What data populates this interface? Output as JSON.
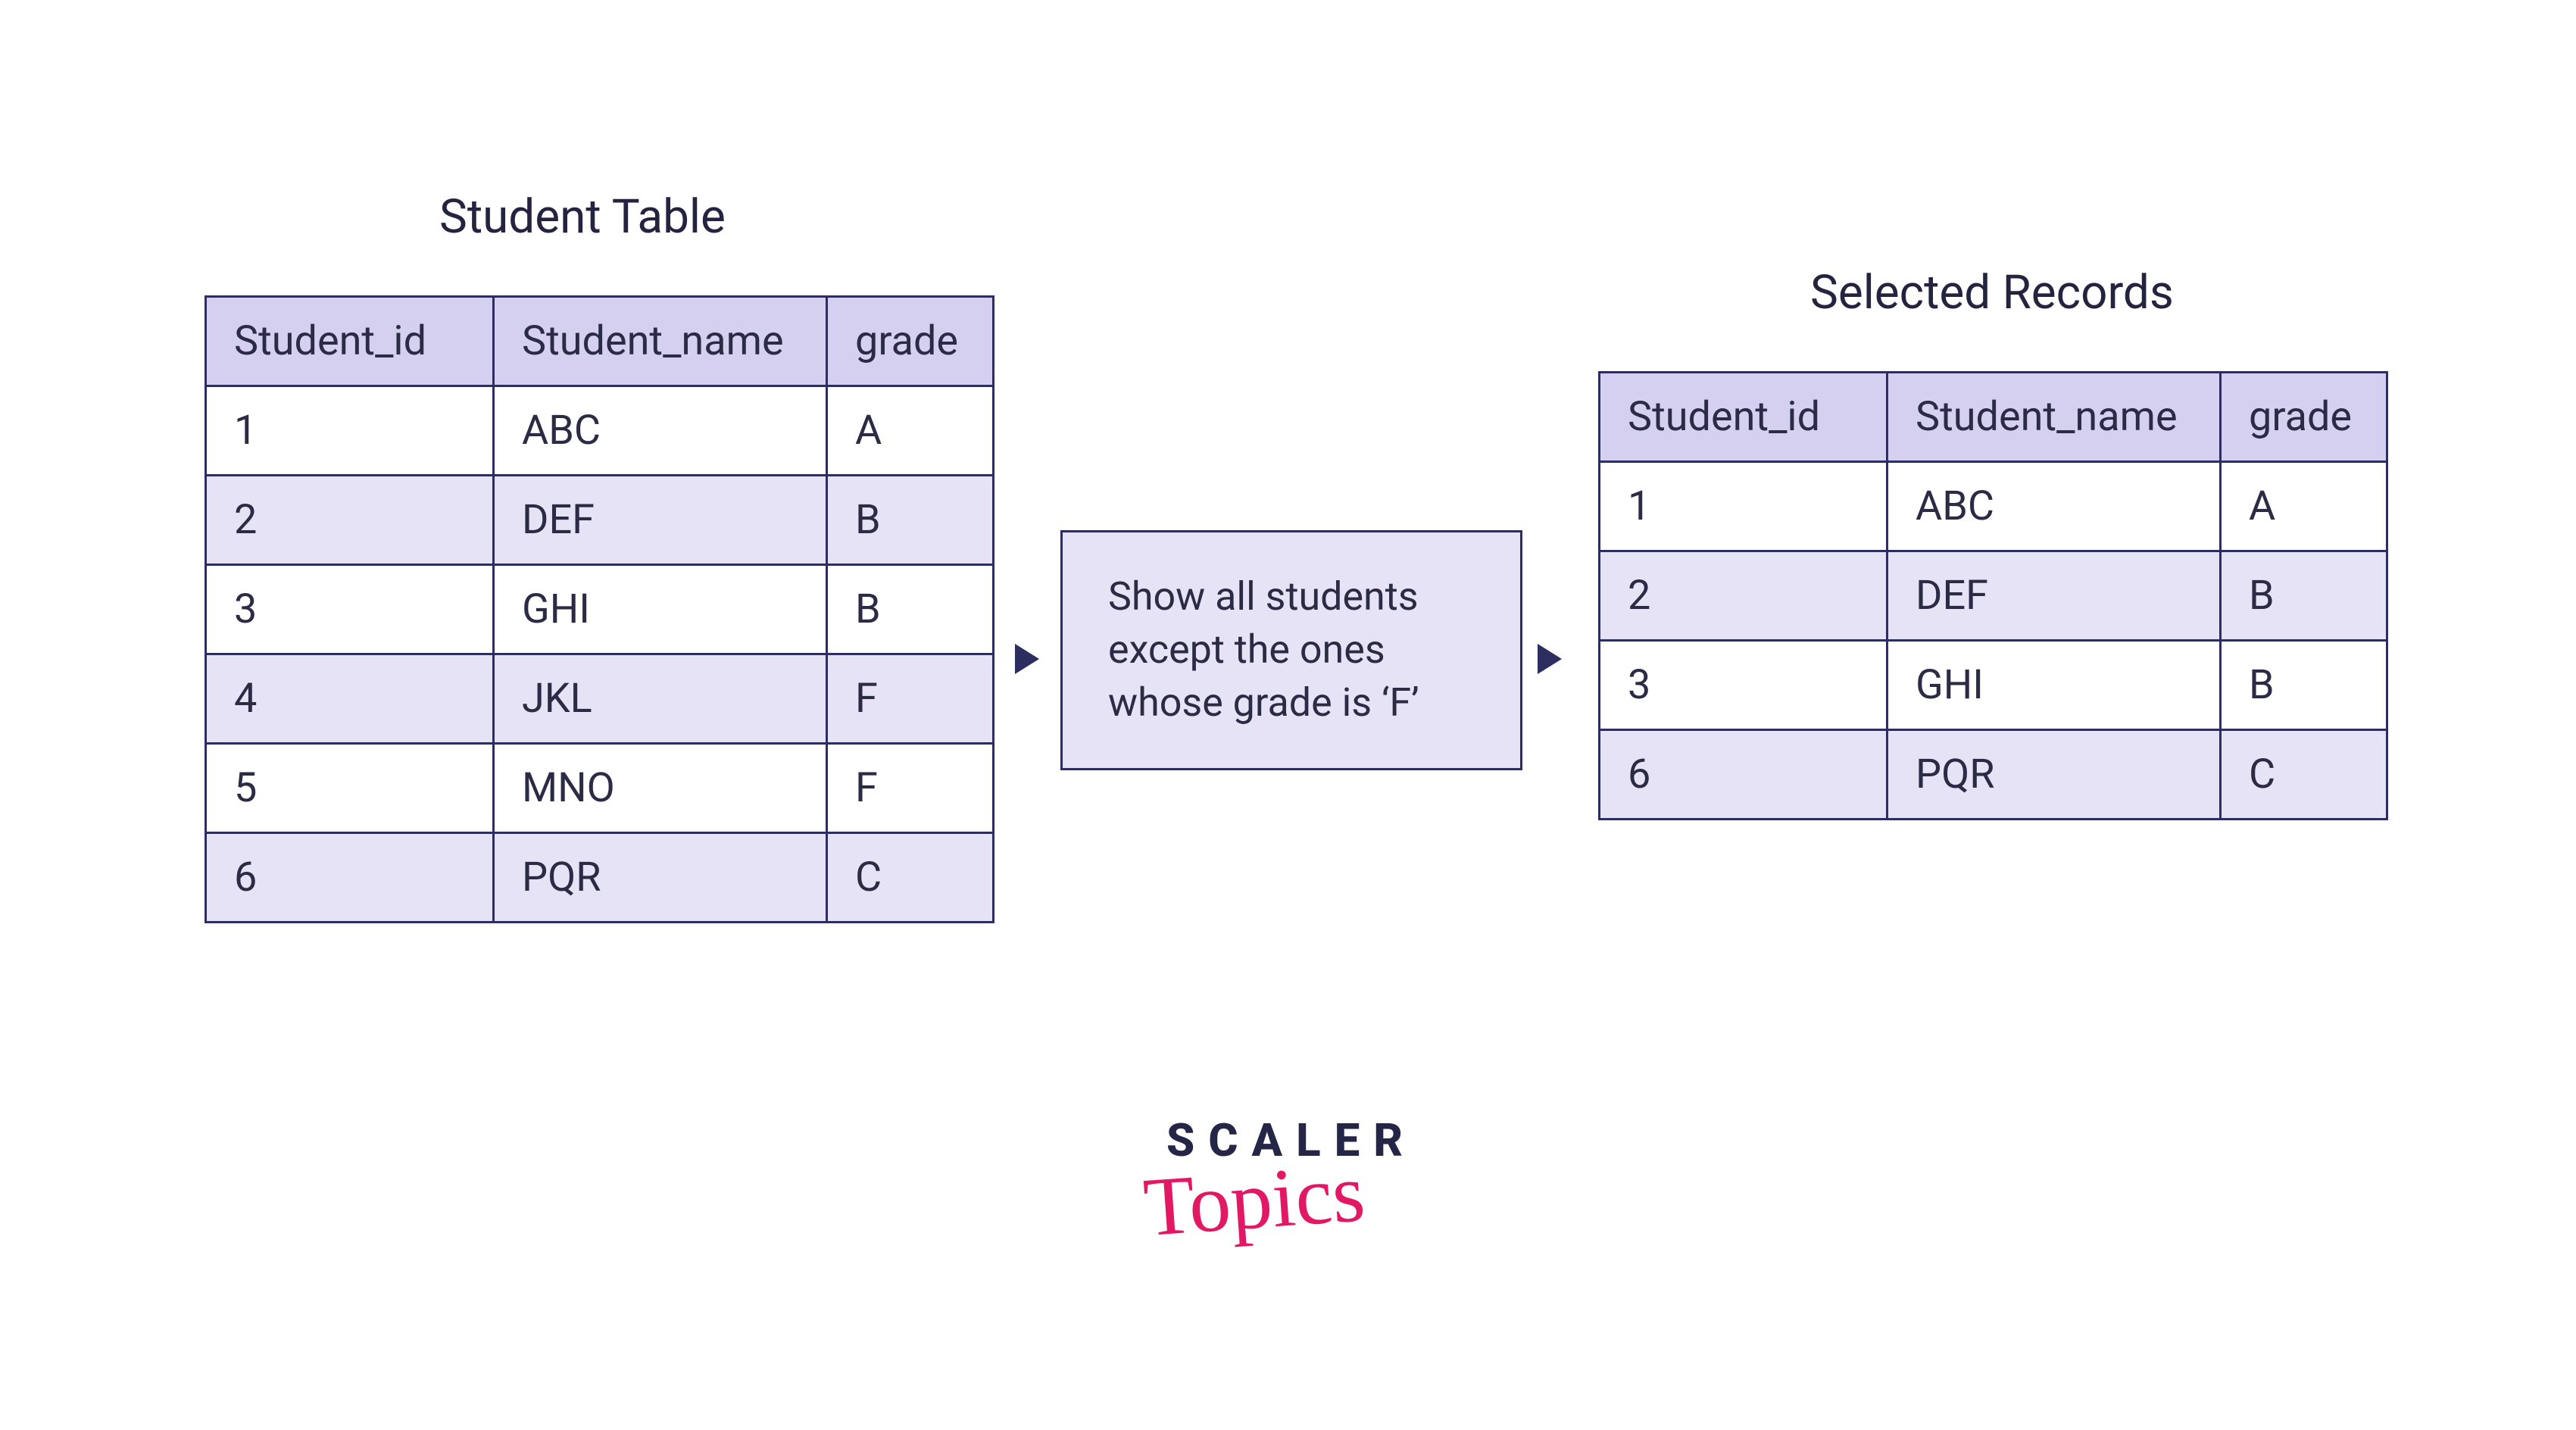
{
  "left_table": {
    "title": "Student Table",
    "headers": [
      "Student_id",
      "Student_name",
      "grade"
    ],
    "rows": [
      {
        "id": "1",
        "name": "ABC",
        "grade": "A"
      },
      {
        "id": "2",
        "name": "DEF",
        "grade": "B"
      },
      {
        "id": "3",
        "name": "GHI",
        "grade": "B"
      },
      {
        "id": "4",
        "name": "JKL",
        "grade": "F"
      },
      {
        "id": "5",
        "name": "MNO",
        "grade": "F"
      },
      {
        "id": "6",
        "name": "PQR",
        "grade": "C"
      }
    ]
  },
  "filter": {
    "text": "Show all students except the ones whose grade is ‘F’"
  },
  "right_table": {
    "title": "Selected Records",
    "headers": [
      "Student_id",
      "Student_name",
      "grade"
    ],
    "rows": [
      {
        "id": "1",
        "name": "ABC",
        "grade": "A"
      },
      {
        "id": "2",
        "name": "DEF",
        "grade": "B"
      },
      {
        "id": "3",
        "name": "GHI",
        "grade": "B"
      },
      {
        "id": "6",
        "name": "PQR",
        "grade": "C"
      }
    ]
  },
  "logo": {
    "line1": "SCALER",
    "line2": "Topics"
  }
}
